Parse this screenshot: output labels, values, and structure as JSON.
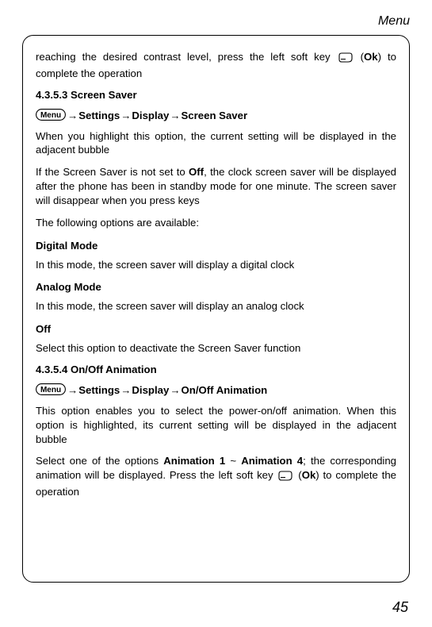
{
  "running_head": "Menu",
  "page_number": "45",
  "intro": {
    "pre": "reaching the desired contrast level, press the left soft key ",
    "ok": "Ok",
    "post": ") to complete the operation"
  },
  "sec1": {
    "num": "4.3.5.3 Screen Saver",
    "nav": {
      "a": "Settings",
      "b": "Display",
      "c": "Screen Saver"
    },
    "p1": "When you highlight this option, the current setting will be displayed in the adjacent bubble",
    "p2a": "If the Screen Saver is not set to ",
    "p2off": "Off",
    "p2b": ", the clock screen saver will be displayed after the phone has been in standby mode for one minute. The screen saver will disappear when you press keys",
    "p3": "The following options are available:",
    "opt1h": "Digital Mode",
    "opt1p": "In this mode, the screen saver will display a digital clock",
    "opt2h": "Analog Mode",
    "opt2p": "In this mode, the screen saver will display an analog clock",
    "opt3h": "Off",
    "opt3p": "Select this option to deactivate the Screen Saver function"
  },
  "sec2": {
    "num": "4.3.5.4 On/Off Animation",
    "nav": {
      "a": "Settings",
      "b": "Display",
      "c": "On/Off Animation"
    },
    "p1": "This option enables you to select the power-on/off animation. When this option is highlighted, its current setting will be displayed in the adjacent bubble",
    "p2a": "Select one of the options ",
    "p2b1": "Animation 1",
    "p2tld": " ~ ",
    "p2b2": "Animation 4",
    "p2c": "; the corresponding animation will be displayed. Press the left soft key ",
    "ok": "Ok",
    "p2d": ") to complete the operation"
  }
}
